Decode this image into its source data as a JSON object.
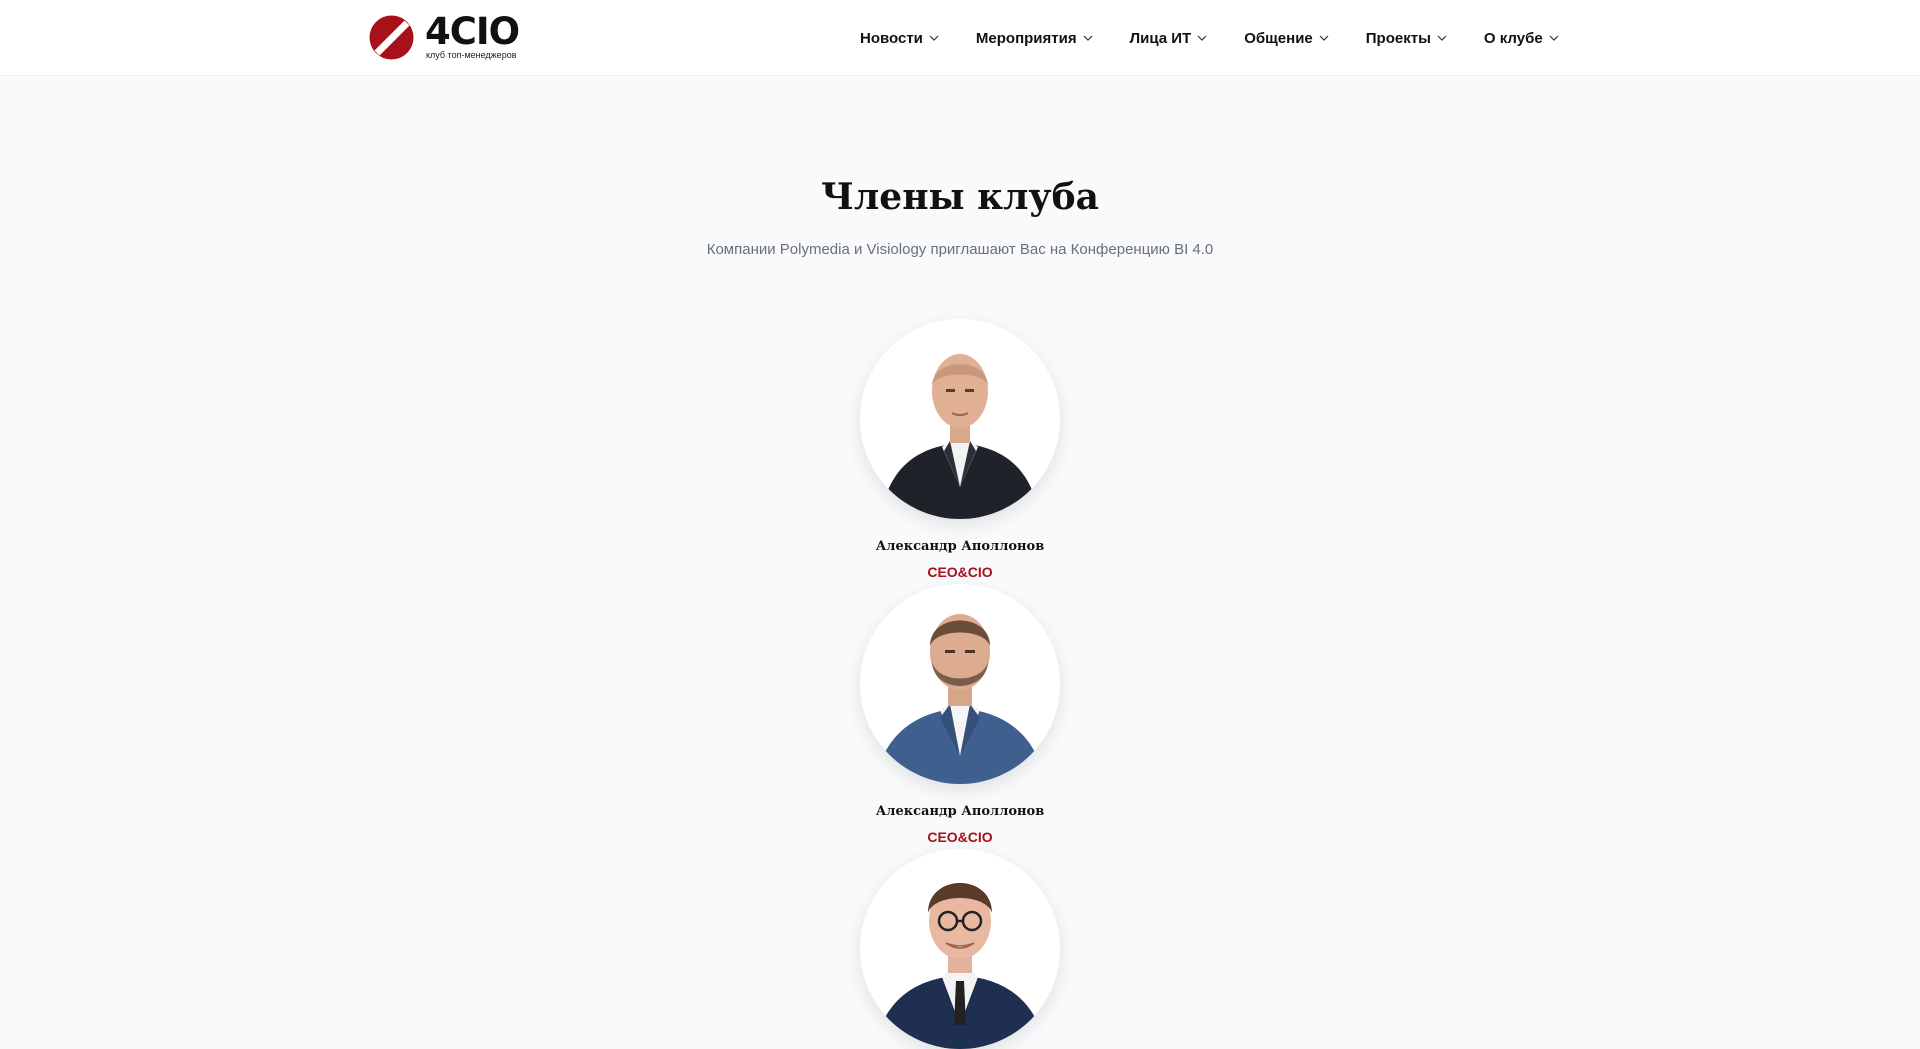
{
  "brand": {
    "name": "4CIO",
    "tagline": "клуб топ-менеджеров",
    "accent": "#a8101a",
    "logo_icon": "slashed-circle-icon"
  },
  "nav": {
    "items": [
      {
        "label": "Новости"
      },
      {
        "label": "Мероприятия"
      },
      {
        "label": "Лица ИТ"
      },
      {
        "label": "Общение"
      },
      {
        "label": "Проекты"
      },
      {
        "label": "О клубе"
      }
    ],
    "dropdown_icon": "chevron-down-icon"
  },
  "page": {
    "title": "Члены клуба",
    "subtitle": "Компании Polymedia и Visiology приглашают Вас на Конференцию BI 4.0"
  },
  "members": [
    {
      "name": "Александр Аполлонов",
      "role": "CEO&CIO",
      "photo": "portrait-bald-man-dark-suit"
    },
    {
      "name": "Александр Аполлонов",
      "role": "CEO&CIO",
      "photo": "portrait-bearded-man-blue-suit"
    },
    {
      "name": "",
      "role": "",
      "photo": "portrait-man-glasses-navy-suit"
    }
  ],
  "colors": {
    "background": "#f9fafc",
    "header": "#ffffff",
    "role_text": "#a8101a"
  }
}
